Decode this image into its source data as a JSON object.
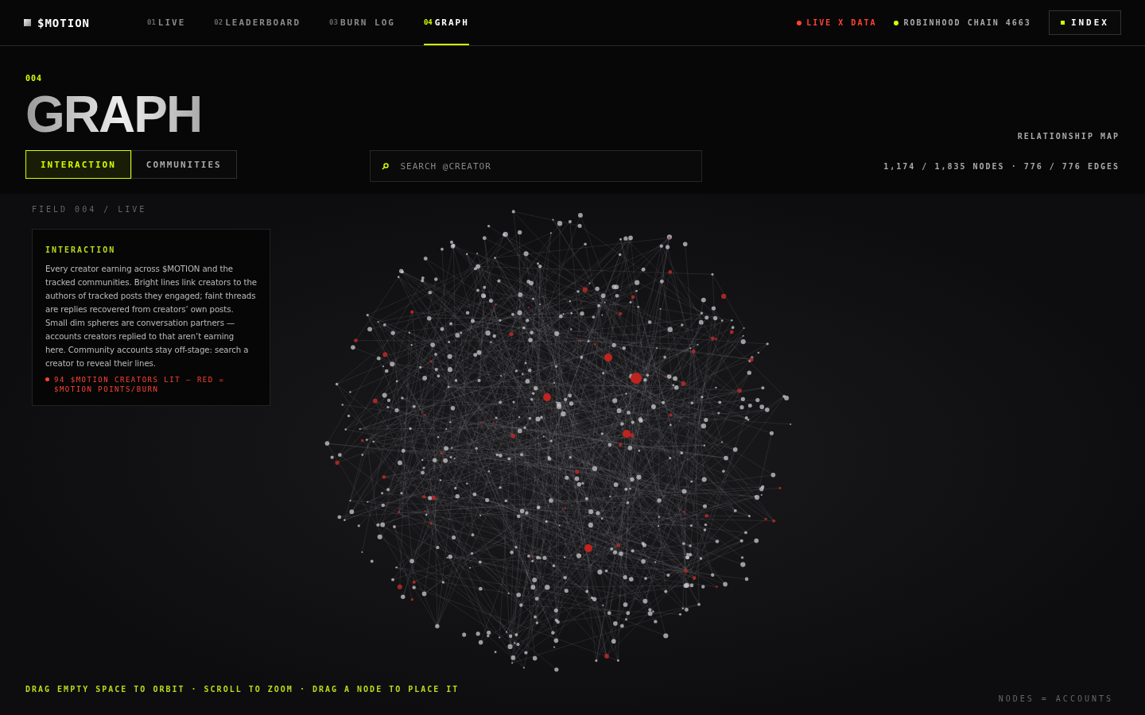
{
  "brand": {
    "name": "$MOTION"
  },
  "nav": [
    {
      "number": "01",
      "label": "LIVE",
      "selected": false
    },
    {
      "number": "02",
      "label": "LEADERBOARD",
      "selected": false
    },
    {
      "number": "03",
      "label": "BURN LOG",
      "selected": false
    },
    {
      "number": "04",
      "label": "GRAPH",
      "selected": true
    }
  ],
  "status": [
    {
      "label": "LIVE X DATA",
      "color": "#ff4433"
    },
    {
      "label": "ROBINHOOD CHAIN 4663",
      "color": "#d4ff00"
    }
  ],
  "index_button": {
    "label": "INDEX"
  },
  "page": {
    "number": "004",
    "title": "GRAPH",
    "subtitle": "RELATIONSHIP MAP",
    "stats": "1,174 / 1,835 NODES · 776 / 776 EDGES"
  },
  "modes": [
    {
      "label": "INTERACTION",
      "selected": true
    },
    {
      "label": "COMMUNITIES",
      "selected": false
    }
  ],
  "search": {
    "placeholder": "SEARCH @CREATOR"
  },
  "field": {
    "label": "FIELD 004 / LIVE",
    "hint": "DRAG EMPTY SPACE TO ORBIT · SCROLL TO ZOOM · DRAG A NODE TO PLACE IT",
    "legend": "NODES = ACCOUNTS"
  },
  "info": {
    "title": "INTERACTION",
    "body": "Every creator earning across $MOTION and the tracked communities. Bright lines link creators to the authors of tracked posts they engaged; faint threads are replies recovered from creators’ own posts. Small dim spheres are conversation partners — accounts creators replied to that aren’t earning here. Community accounts stay off-stage: search a creator to reveal their lines.",
    "note": "94 $MOTION CREATORS LIT — RED = $MOTION POINTS/BURN"
  }
}
